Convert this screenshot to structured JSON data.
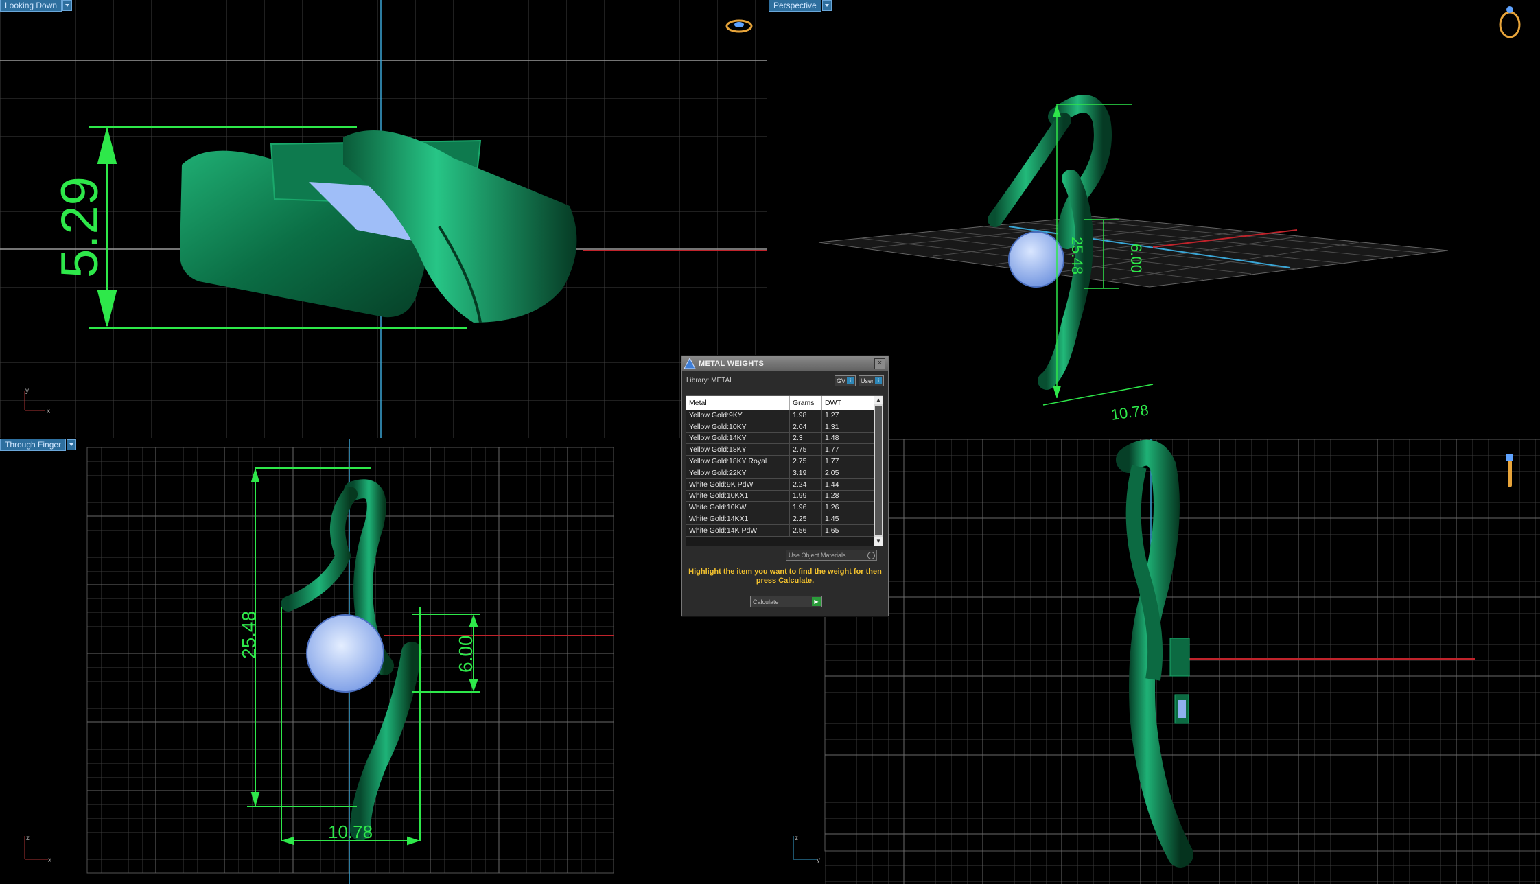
{
  "viewports": {
    "top_left": {
      "label": "Looking Down",
      "axis_a": "y",
      "axis_b": "x"
    },
    "top_right": {
      "label": "Perspective"
    },
    "bottom_left": {
      "label": "Through Finger",
      "axis_a": "z",
      "axis_b": "x"
    },
    "bottom_right": {
      "axis_a": "z",
      "axis_b": "y"
    }
  },
  "dimensions": {
    "height_top": "5.29",
    "length_persp": "25.48",
    "stone_persp": "6.00",
    "width_persp": "10.78",
    "length_front": "25.48",
    "stone_front": "6.00",
    "width_front": "10.78"
  },
  "dialog": {
    "title": "METAL WEIGHTS",
    "library_label": "Library: METAL",
    "gv_label": "GV",
    "user_label": "User",
    "columns": [
      "Metal",
      "Grams",
      "DWT"
    ],
    "rows": [
      [
        "Yellow Gold:9KY",
        "1.98",
        "1,27"
      ],
      [
        "Yellow Gold:10KY",
        "2.04",
        "1,31"
      ],
      [
        "Yellow Gold:14KY",
        "2.3",
        "1,48"
      ],
      [
        "Yellow Gold:18KY",
        "2.75",
        "1,77"
      ],
      [
        "Yellow Gold:18KY Royal",
        "2.75",
        "1,77"
      ],
      [
        "Yellow Gold:22KY",
        "3.19",
        "2,05"
      ],
      [
        "White Gold:9K PdW",
        "2.24",
        "1,44"
      ],
      [
        "White Gold:10KX1",
        "1.99",
        "1,28"
      ],
      [
        "White Gold:10KW",
        "1.96",
        "1,26"
      ],
      [
        "White Gold:14KX1",
        "2.25",
        "1,45"
      ],
      [
        "White Gold:14K PdW",
        "2.56",
        "1,65"
      ]
    ],
    "use_object_materials": "Use Object Materials",
    "hint": "Highlight the item you want to find the weight for then press Calculate.",
    "calculate_label": "Calculate"
  },
  "colors": {
    "metal": "#0f7a4e",
    "stone": "#8fb0f0",
    "dimension": "#2ee84a",
    "grid": "#4a4a4a",
    "tab": "#2e6f9e",
    "hint_text": "#f3c22e"
  },
  "icons": [
    "ring-view-icon",
    "ring-perspective-icon",
    "pendant-side-icon",
    "metal-weights-logo-icon",
    "close-icon"
  ]
}
